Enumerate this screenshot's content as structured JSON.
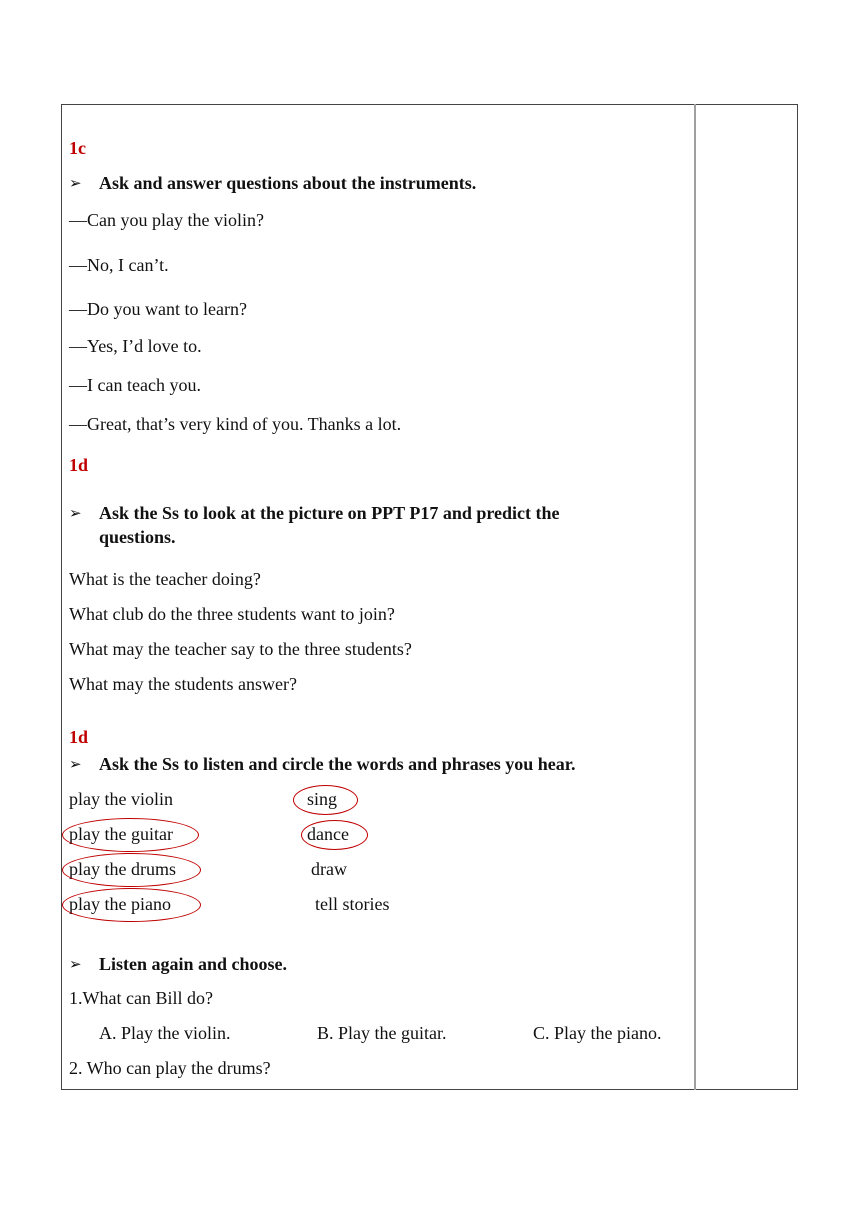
{
  "section_1c": {
    "heading": "1c",
    "instruction": "Ask and answer questions about the instruments.",
    "dialogue": [
      "—Can you play the violin?",
      "—No, I can’t.",
      "—Do you want to learn?",
      "—Yes, I’d love to.",
      "—I can teach you.",
      "—Great, that’s very kind of you. Thanks a lot."
    ]
  },
  "section_1d_predict": {
    "heading": "1d",
    "instruction_line1": "Ask the Ss to look at the picture on PPT P17 and predict the",
    "instruction_line2": "questions.",
    "questions": [
      "What is the teacher doing?",
      "What club do the three students want to join?",
      "What may the teacher say to the three students?",
      "What may the students answer?"
    ]
  },
  "section_1d_listen": {
    "heading": "1d",
    "instruction": "Ask the Ss to listen and circle the words and phrases you hear.",
    "left_items": [
      {
        "text": "play the violin",
        "circled": false
      },
      {
        "text": "play the guitar",
        "circled": true
      },
      {
        "text": "play the drums",
        "circled": true
      },
      {
        "text": "play the piano",
        "circled": true
      }
    ],
    "right_items": [
      {
        "text": "sing",
        "circled": true
      },
      {
        "text": "dance",
        "circled": true
      },
      {
        "text": "draw",
        "circled": false
      },
      {
        "text": "tell stories",
        "circled": false
      }
    ]
  },
  "section_listen_again": {
    "instruction": "Listen again and choose.",
    "q1": "1.What can Bill do?",
    "q1_options": [
      "A. Play the violin.",
      "B. Play the guitar.",
      "C. Play the piano."
    ],
    "q2": "2. Who can play the drums?"
  },
  "bullet_glyph": "➢",
  "circle_color": "#c00000",
  "heading_color": "#c00000"
}
